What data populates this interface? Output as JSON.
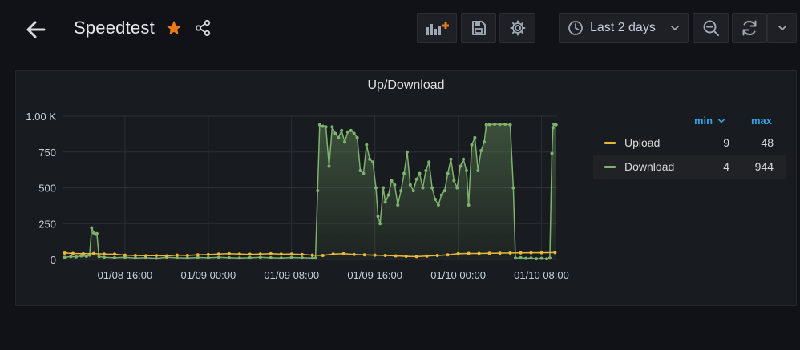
{
  "header": {
    "title": "Speedtest",
    "timerange": "Last 2 days"
  },
  "colors": {
    "upload": "#eab839",
    "download": "#7eb26d",
    "accent": "#33a2e5",
    "star": "#eb7b18"
  },
  "icons": {
    "back": "arrow-left-icon",
    "star": "star-icon",
    "share": "share-icon",
    "add_panel": "add-panel-icon",
    "save": "save-icon",
    "settings": "gear-icon",
    "clock": "clock-icon",
    "zoom_out": "zoom-out-icon",
    "refresh": "refresh-icon",
    "dropdown": "chevron-down-icon"
  },
  "panel": {
    "title": "Up/Download"
  },
  "legend": {
    "min_label": "min",
    "max_label": "max",
    "rows": [
      {
        "name": "Upload",
        "min": "9",
        "max": "48"
      },
      {
        "name": "Download",
        "min": "4",
        "max": "944"
      }
    ]
  },
  "chart_data": {
    "type": "line",
    "title": "Up/Download",
    "y_ticks": [
      "0",
      "250",
      "500",
      "750",
      "1.00 K"
    ],
    "ylim": [
      0,
      1000
    ],
    "x_ticks": [
      {
        "t": 16,
        "label": "01/08 16:00"
      },
      {
        "t": 24,
        "label": "01/09 00:00"
      },
      {
        "t": 32,
        "label": "01/09 08:00"
      },
      {
        "t": 40,
        "label": "01/09 16:00"
      },
      {
        "t": 48,
        "label": "01/10 00:00"
      },
      {
        "t": 56,
        "label": "01/10 08:00"
      }
    ],
    "xlim": [
      10,
      57.5
    ],
    "grid": true,
    "legend_position": "right",
    "series": [
      {
        "name": "Upload",
        "area": false,
        "points": [
          [
            10.2,
            45
          ],
          [
            11,
            42
          ],
          [
            12,
            40
          ],
          [
            13,
            41
          ],
          [
            14,
            38
          ],
          [
            15,
            37
          ],
          [
            16,
            30
          ],
          [
            17,
            28
          ],
          [
            18,
            26
          ],
          [
            19,
            27
          ],
          [
            20,
            25
          ],
          [
            21,
            30
          ],
          [
            22,
            28
          ],
          [
            23,
            32
          ],
          [
            24,
            34
          ],
          [
            25,
            38
          ],
          [
            26,
            40
          ],
          [
            27,
            38
          ],
          [
            28,
            36
          ],
          [
            29,
            38
          ],
          [
            30,
            40
          ],
          [
            31,
            37
          ],
          [
            32,
            38
          ],
          [
            33,
            35
          ],
          [
            34,
            30
          ],
          [
            35,
            28
          ],
          [
            36,
            38
          ],
          [
            37,
            40
          ],
          [
            38,
            35
          ],
          [
            39,
            32
          ],
          [
            40,
            30
          ],
          [
            41,
            28
          ],
          [
            42,
            25
          ],
          [
            43,
            22
          ],
          [
            44,
            20
          ],
          [
            45,
            24
          ],
          [
            46,
            28
          ],
          [
            47,
            32
          ],
          [
            48,
            40
          ],
          [
            49,
            42
          ],
          [
            50,
            42
          ],
          [
            51,
            43
          ],
          [
            52,
            44
          ],
          [
            53,
            45
          ],
          [
            54,
            46
          ],
          [
            55,
            47
          ],
          [
            56,
            47
          ],
          [
            57.3,
            48
          ]
        ]
      },
      {
        "name": "Download",
        "area": true,
        "points": [
          [
            10.2,
            15
          ],
          [
            10.8,
            20
          ],
          [
            11.3,
            18
          ],
          [
            11.8,
            25
          ],
          [
            12.3,
            22
          ],
          [
            12.6,
            30
          ],
          [
            12.8,
            220
          ],
          [
            13.0,
            185
          ],
          [
            13.2,
            175
          ],
          [
            13.3,
            180
          ],
          [
            13.5,
            20
          ],
          [
            14,
            15
          ],
          [
            15,
            12
          ],
          [
            16,
            15
          ],
          [
            17,
            10
          ],
          [
            18,
            12
          ],
          [
            19,
            8
          ],
          [
            20,
            15
          ],
          [
            21,
            12
          ],
          [
            22,
            10
          ],
          [
            23,
            14
          ],
          [
            24,
            12
          ],
          [
            25,
            15
          ],
          [
            26,
            12
          ],
          [
            27,
            10
          ],
          [
            28,
            12
          ],
          [
            29,
            15
          ],
          [
            30,
            12
          ],
          [
            31,
            10
          ],
          [
            32,
            14
          ],
          [
            33,
            12
          ],
          [
            34,
            10
          ],
          [
            34.3,
            10
          ],
          [
            34.5,
            480
          ],
          [
            34.7,
            940
          ],
          [
            35.0,
            930
          ],
          [
            35.3,
            925
          ],
          [
            35.6,
            650
          ],
          [
            35.9,
            925
          ],
          [
            36.2,
            880
          ],
          [
            36.5,
            850
          ],
          [
            36.8,
            900
          ],
          [
            37.1,
            820
          ],
          [
            37.4,
            890
          ],
          [
            37.7,
            900
          ],
          [
            38.0,
            880
          ],
          [
            38.3,
            850
          ],
          [
            38.6,
            620
          ],
          [
            38.9,
            600
          ],
          [
            39.2,
            800
          ],
          [
            39.5,
            700
          ],
          [
            39.8,
            680
          ],
          [
            40.1,
            500
          ],
          [
            40.3,
            300
          ],
          [
            40.5,
            250
          ],
          [
            40.8,
            500
          ],
          [
            41.0,
            400
          ],
          [
            41.3,
            450
          ],
          [
            41.6,
            550
          ],
          [
            41.9,
            520
          ],
          [
            42.2,
            380
          ],
          [
            42.5,
            480
          ],
          [
            42.8,
            600
          ],
          [
            43.1,
            750
          ],
          [
            43.4,
            520
          ],
          [
            43.7,
            480
          ],
          [
            44.0,
            560
          ],
          [
            44.3,
            600
          ],
          [
            44.6,
            500
          ],
          [
            44.9,
            620
          ],
          [
            45.2,
            680
          ],
          [
            45.5,
            500
          ],
          [
            45.8,
            420
          ],
          [
            46.1,
            380
          ],
          [
            46.4,
            450
          ],
          [
            46.7,
            480
          ],
          [
            47.0,
            600
          ],
          [
            47.3,
            700
          ],
          [
            47.6,
            550
          ],
          [
            47.9,
            500
          ],
          [
            48.2,
            650
          ],
          [
            48.5,
            700
          ],
          [
            48.8,
            620
          ],
          [
            49.0,
            380
          ],
          [
            49.3,
            800
          ],
          [
            49.6,
            850
          ],
          [
            49.9,
            620
          ],
          [
            50.2,
            760
          ],
          [
            50.5,
            820
          ],
          [
            50.7,
            940
          ],
          [
            51.0,
            942
          ],
          [
            51.5,
            944
          ],
          [
            52.0,
            943
          ],
          [
            52.5,
            944
          ],
          [
            53.0,
            940
          ],
          [
            53.3,
            500
          ],
          [
            53.5,
            10
          ],
          [
            54,
            12
          ],
          [
            54.5,
            8
          ],
          [
            55,
            10
          ],
          [
            55.5,
            5
          ],
          [
            56,
            8
          ],
          [
            56.5,
            4
          ],
          [
            56.8,
            10
          ],
          [
            57.0,
            740
          ],
          [
            57.1,
            920
          ],
          [
            57.2,
            944
          ],
          [
            57.4,
            940
          ]
        ]
      }
    ]
  }
}
